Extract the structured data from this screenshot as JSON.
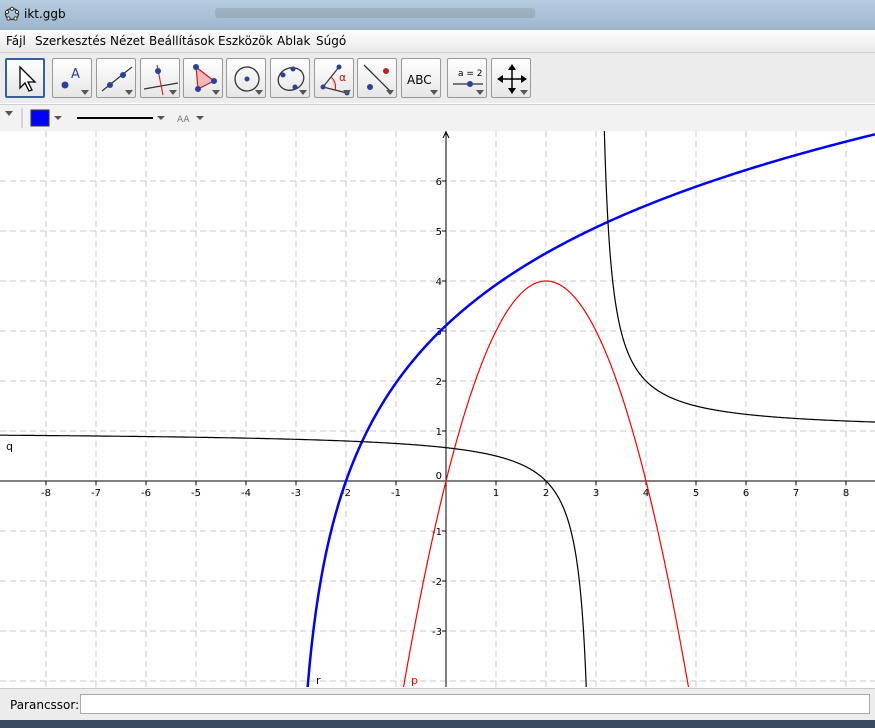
{
  "window": {
    "title": "ikt.ggb"
  },
  "menu": [
    "Fájl",
    "Szerkesztés",
    "Nézet",
    "Beállítások",
    "Eszközök",
    "Ablak",
    "Súgó"
  ],
  "toolbar": {
    "tools": [
      {
        "name": "move-tool-button",
        "icon": "arrow-cursor-icon"
      },
      {
        "name": "point-tool-button",
        "icon": "point-icon",
        "label": "A"
      },
      {
        "name": "line-tool-button",
        "icon": "line-icon"
      },
      {
        "name": "perpendicular-line-tool-button",
        "icon": "perpendicular-line-icon"
      },
      {
        "name": "polygon-tool-button",
        "icon": "polygon-icon"
      },
      {
        "name": "circle-tool-button",
        "icon": "circle-icon"
      },
      {
        "name": "conic-tool-button",
        "icon": "conic-icon"
      },
      {
        "name": "angle-tool-button",
        "icon": "angle-icon",
        "label": "α"
      },
      {
        "name": "reflect-tool-button",
        "icon": "reflect-icon"
      },
      {
        "name": "text-tool-button",
        "icon": "text-icon",
        "label": "ABC"
      },
      {
        "name": "slider-tool-button",
        "icon": "slider-icon",
        "label": "a = 2"
      },
      {
        "name": "move-graphics-view-button",
        "icon": "move-view-icon"
      }
    ]
  },
  "stylebar": {
    "color": "#0000ff",
    "font_size_label": "AA"
  },
  "graph": {
    "x_ticks": [
      "-8",
      "-7",
      "-6",
      "-5",
      "-4",
      "-3",
      "-2",
      "-1",
      "0",
      "1",
      "2",
      "3",
      "4",
      "5",
      "6",
      "7",
      "8"
    ],
    "y_ticks": [
      "-3",
      "-2",
      "-1",
      "1",
      "2",
      "3",
      "4",
      "5",
      "6"
    ],
    "zero_label": "0",
    "functions": [
      {
        "label": "r",
        "color": "#0000ff",
        "description": "log curve"
      },
      {
        "label": "p",
        "color": "#ff0000",
        "description": "parabola"
      },
      {
        "label": "q",
        "color": "#000000",
        "description": "hyperbola"
      }
    ]
  },
  "input": {
    "label": "Parancssor:",
    "value": ""
  }
}
